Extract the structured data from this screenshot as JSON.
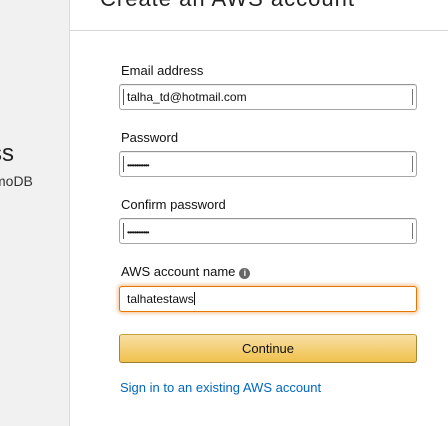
{
  "page": {
    "title": "Create an AWS account"
  },
  "left": {
    "heading": "ss",
    "sub": "moDB"
  },
  "form": {
    "email": {
      "label": "Email address",
      "value": "talha_td@hotmail.com"
    },
    "password": {
      "label": "Password",
      "value": "••••••••••••"
    },
    "confirm": {
      "label": "Confirm password",
      "value": "••••••••••••"
    },
    "account": {
      "label": "AWS account name",
      "value": "talhatestaws"
    },
    "continue_label": "Continue",
    "signin_link": "Sign in to an existing AWS account"
  },
  "colors": {
    "button_gold": "#f0c14b",
    "link_blue": "#0066c0",
    "focus_orange": "#e77600"
  }
}
